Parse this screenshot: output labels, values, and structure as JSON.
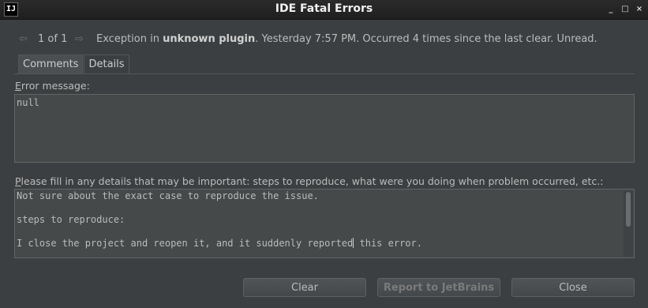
{
  "window": {
    "title": "IDE Fatal Errors",
    "app_icon_text": "IJ",
    "minimize": "_",
    "maximize": "□",
    "close": "×"
  },
  "header": {
    "prev_arrow": "⇦",
    "next_arrow": "⇨",
    "count": "1 of 1",
    "exception_prefix": "Exception in ",
    "plugin": "unknown plugin",
    "details": ". Yesterday 7:57 PM. Occurred 4 times since the last clear. Unread."
  },
  "tabs": [
    {
      "label": "Comments",
      "selected": true
    },
    {
      "label": "Details",
      "selected": false
    }
  ],
  "error_message": {
    "label_mnemonic": "E",
    "label_rest": "rror message:",
    "value": "null"
  },
  "details_section": {
    "label_mnemonic": "P",
    "label_rest": "lease fill in any details that may be important: steps to reproduce, what were you doing when problem occurred, etc.:",
    "lines": [
      "Not sure about the exact case to reproduce the issue.",
      "",
      "steps to reproduce:",
      "",
      "I close the project and reopen it, and it suddenly reported",
      " this error."
    ]
  },
  "buttons": {
    "clear": "Clear",
    "report": "Report to JetBrains",
    "close": "Close"
  }
}
